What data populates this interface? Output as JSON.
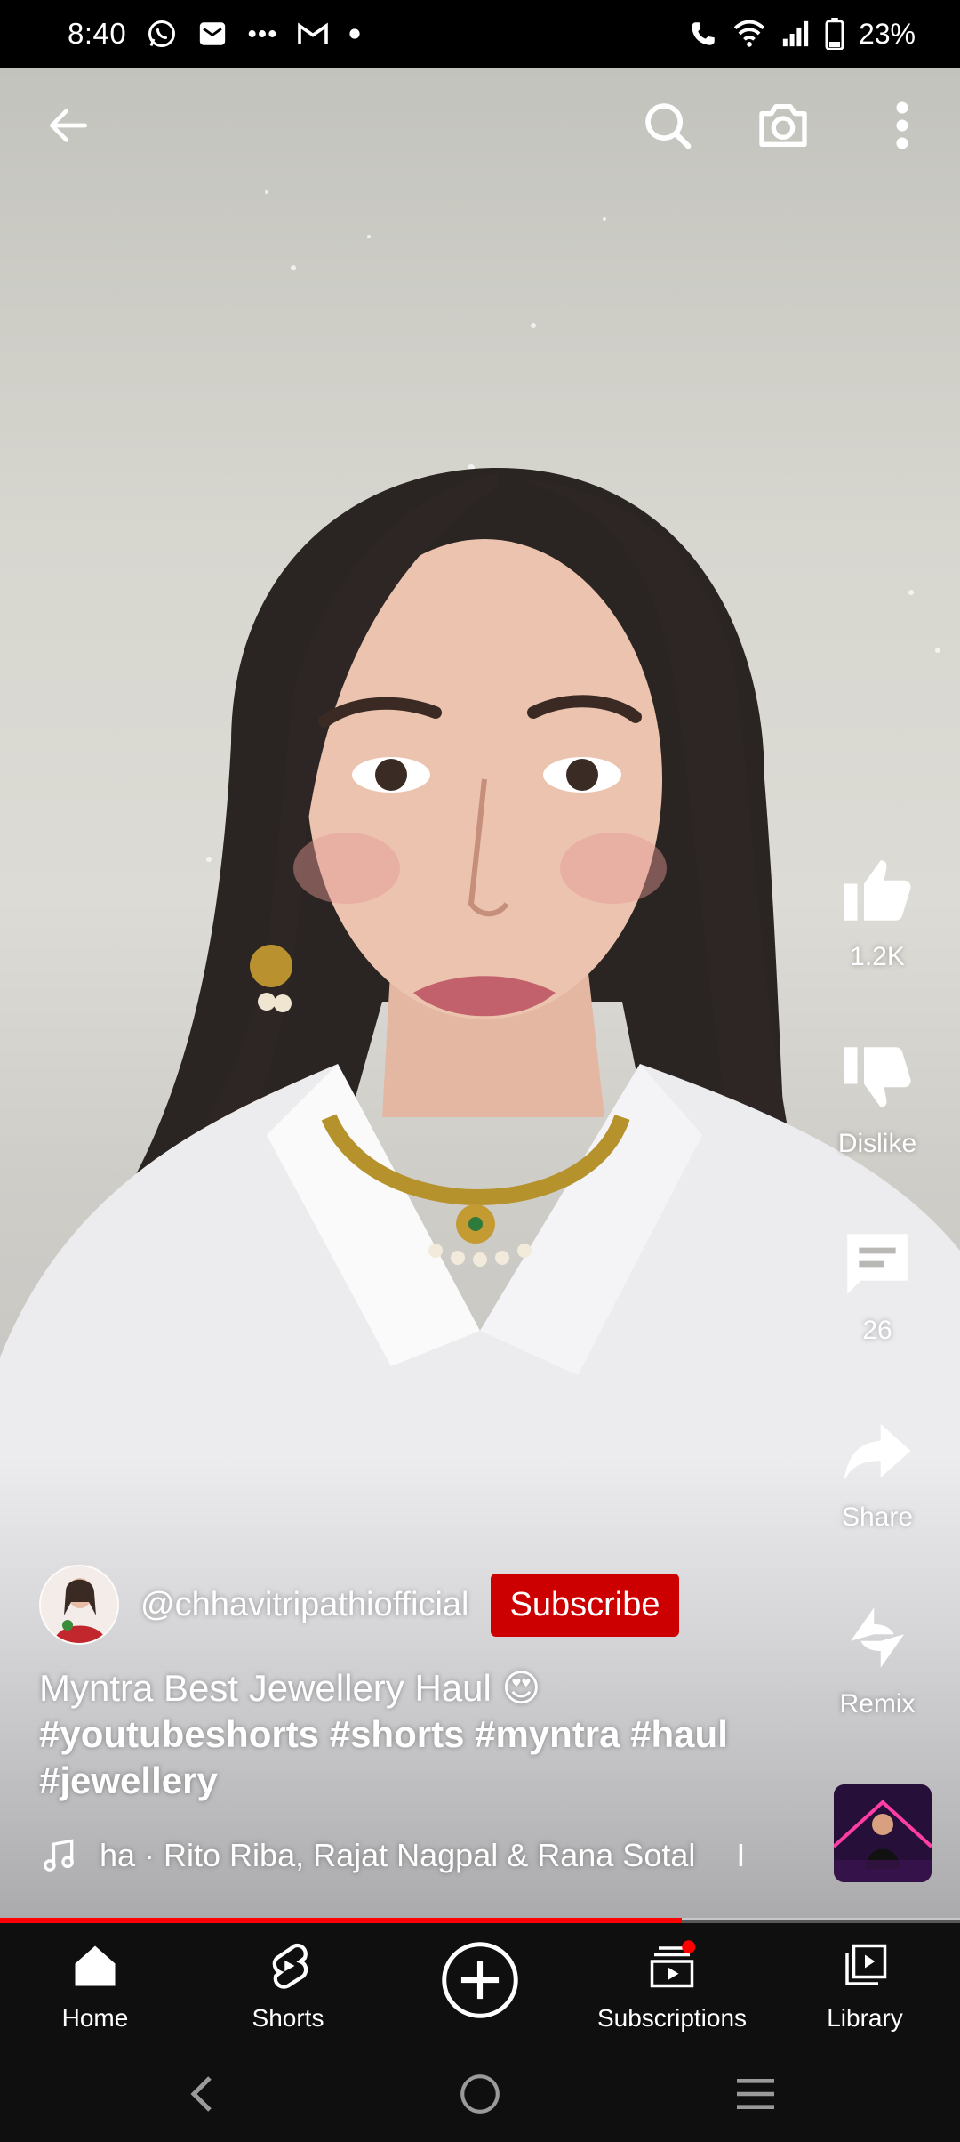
{
  "status_bar": {
    "time": "8:40",
    "battery": "23%",
    "icons_left": [
      "whatsapp-icon",
      "gmail-icon",
      "more-dots-icon",
      "gmail-icon",
      "dot-icon"
    ],
    "icons_right": [
      "wifi-call-icon",
      "wifi-icon",
      "signal-icon",
      "battery-icon"
    ]
  },
  "top_bar": {
    "back_icon": "back-arrow-icon",
    "search_icon": "search-icon",
    "camera_icon": "camera-icon",
    "more_icon": "more-vert-icon"
  },
  "actions": {
    "like_count": "1.2K",
    "dislike_label": "Dislike",
    "comments_count": "26",
    "share_label": "Share",
    "remix_label": "Remix"
  },
  "video": {
    "channel_handle": "@chhavitripathiofficial",
    "subscribe_label": "Subscribe",
    "title_text": "Myntra Best Jewellery Haul 😍",
    "hashtags": "#youtubeshorts #shorts #myntra #haul #jewellery",
    "music_text": "ha · Rito Riba, Rajat Nagpal & Rana Sotal",
    "music_cursor": "I",
    "progress": 0.71
  },
  "bottom_nav": {
    "items": [
      {
        "label": "Home"
      },
      {
        "label": "Shorts"
      },
      {
        "label": ""
      },
      {
        "label": "Subscriptions"
      },
      {
        "label": "Library"
      }
    ]
  },
  "colors": {
    "accent_red": "#cc0000",
    "progress_red": "#ff0000",
    "nav_bg": "#0f0f0f"
  }
}
